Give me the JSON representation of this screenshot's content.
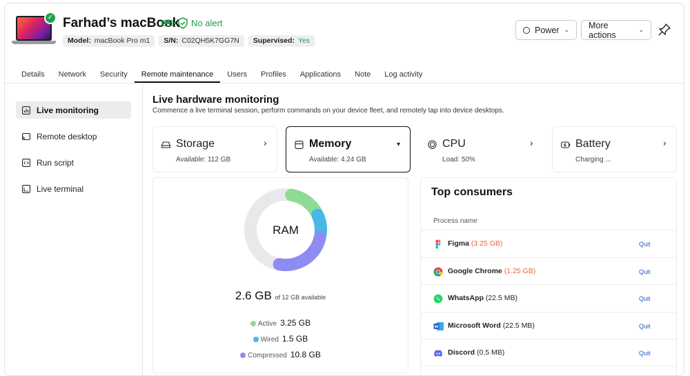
{
  "device": {
    "name": "Farhad’s macBook",
    "alert_text": "No alert",
    "chips": [
      {
        "label": "Model:",
        "value": "macBook Pro m1"
      },
      {
        "label": "S/N:",
        "value": "C02QH5K7GG7N"
      },
      {
        "label": "Supervised:",
        "value": "Yes"
      }
    ]
  },
  "actions": {
    "power_label": "Power",
    "more_label": "More actions"
  },
  "tabs": [
    "Details",
    "Network",
    "Security",
    "Remote maintenance",
    "Users",
    "Profiles",
    "Applications",
    "Note",
    "Log activity"
  ],
  "active_tab": "Remote maintenance",
  "sidebar": {
    "items": [
      {
        "label": "Live monitoring",
        "icon": "chart-icon"
      },
      {
        "label": "Remote desktop",
        "icon": "cast-icon"
      },
      {
        "label": "Run script",
        "icon": "code-icon"
      },
      {
        "label": "Live terminal",
        "icon": "terminal-icon"
      }
    ]
  },
  "main": {
    "title": "Live hardware monitoring",
    "subtitle": "Commence a live terminal session, perform commands on your device fleet, and remotely tap into device desktops."
  },
  "cards": [
    {
      "name": "Storage",
      "sub": "Available: 112 GB",
      "icon": "drive-icon"
    },
    {
      "name": "Memory",
      "sub": "Available: 4.24 GB",
      "icon": "memory-icon"
    },
    {
      "name": "CPU",
      "sub": "Load: 50%",
      "icon": "cpu-icon"
    },
    {
      "name": "Battery",
      "sub": "Charging ...",
      "icon": "battery-icon"
    }
  ],
  "ram": {
    "center_label": "RAM",
    "used": "2.6 GB",
    "of_text": "of 12 GB available",
    "total_gb": 12,
    "legend": [
      {
        "name": "Active",
        "value": "3.25 GB",
        "color": "#8fdb94"
      },
      {
        "name": "Wired",
        "value": "1.5 GB",
        "color": "#4ab8e6"
      },
      {
        "name": "Compressed",
        "value": "10.8 GB",
        "color": "#8e8cf2"
      }
    ],
    "free_color": "#e9e9eb"
  },
  "consumers": {
    "title": "Top consumers",
    "column": "Process name",
    "quit_label": "Quit",
    "rows": [
      {
        "name": "Figma",
        "usage": "(3.25 GB)",
        "hot": true,
        "icon": "figma-icon"
      },
      {
        "name": "Google Chrome",
        "usage": "(1.25 GB)",
        "hot": true,
        "icon": "chrome-icon"
      },
      {
        "name": "WhatsApp",
        "usage": "(22.5 MB)",
        "hot": false,
        "icon": "whatsapp-icon"
      },
      {
        "name": "Microsoft Word",
        "usage": "(22.5 MB)",
        "hot": false,
        "icon": "word-icon"
      },
      {
        "name": "Discord",
        "usage": "(0.5 MB)",
        "hot": false,
        "icon": "discord-icon"
      }
    ]
  },
  "colors": {
    "success": "#1f9a48",
    "accent_hot": "#e6662d",
    "link": "#2456c9"
  }
}
